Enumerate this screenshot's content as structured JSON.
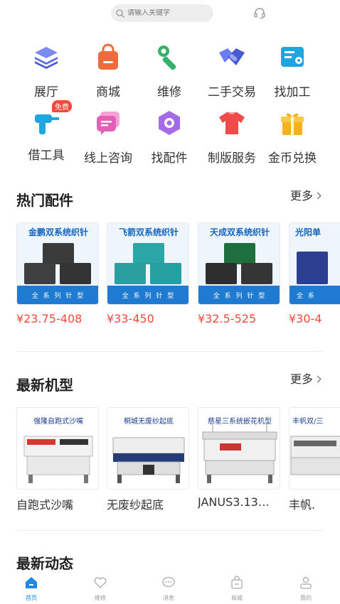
{
  "search": {
    "placeholder": "请输入关键字"
  },
  "categories": [
    {
      "label": "展厅",
      "icon": "layers-icon"
    },
    {
      "label": "商城",
      "icon": "shopping-bag-icon"
    },
    {
      "label": "维修",
      "icon": "wrench-icon"
    },
    {
      "label": "二手交易",
      "icon": "handshake-icon"
    },
    {
      "label": "找加工",
      "icon": "factory-icon"
    },
    {
      "label": "借工具",
      "icon": "drill-icon",
      "badge": "免费"
    },
    {
      "label": "线上咨询",
      "icon": "chat-icon"
    },
    {
      "label": "找配件",
      "icon": "hex-nut-icon"
    },
    {
      "label": "制版服务",
      "icon": "tshirt-icon"
    },
    {
      "label": "金币兑换",
      "icon": "gift-icon"
    }
  ],
  "hot_parts": {
    "title": "热门配件",
    "more": "更多",
    "items": [
      {
        "title": "金鹏双系统织针",
        "price": "¥23.75-408",
        "band": "全 系 列 针 型"
      },
      {
        "title": "飞箭双系统织针",
        "price": "¥33-450",
        "band": "全 系 列 针 型"
      },
      {
        "title": "天成双系统织针",
        "price": "¥32.5-525",
        "band": "全 系 列 针 型"
      },
      {
        "title": "光阳单",
        "price": "¥30-4",
        "band": "全 系"
      }
    ]
  },
  "new_machines": {
    "title": "最新机型",
    "more": "更多",
    "items": [
      {
        "caption": "强隆自跑式沙嘴",
        "name": "自跑式沙嘴"
      },
      {
        "caption": "桐城无废纱起底",
        "name": "无废纱起底"
      },
      {
        "caption": "慈星三系统嵌花机型",
        "name": "JANUS3.13…"
      },
      {
        "caption": "丰帆双/三",
        "name": "丰帆."
      }
    ]
  },
  "news": {
    "title": "最新动态"
  },
  "tabs": [
    {
      "label": "首页",
      "icon": "home-icon",
      "active": true
    },
    {
      "label": "维修",
      "icon": "heart-icon"
    },
    {
      "label": "消息",
      "icon": "message-icon"
    },
    {
      "label": "商城",
      "icon": "bag-icon"
    },
    {
      "label": "我的",
      "icon": "user-icon"
    }
  ],
  "colors": {
    "accent": "#1e88e5",
    "price": "#f04b3c"
  }
}
